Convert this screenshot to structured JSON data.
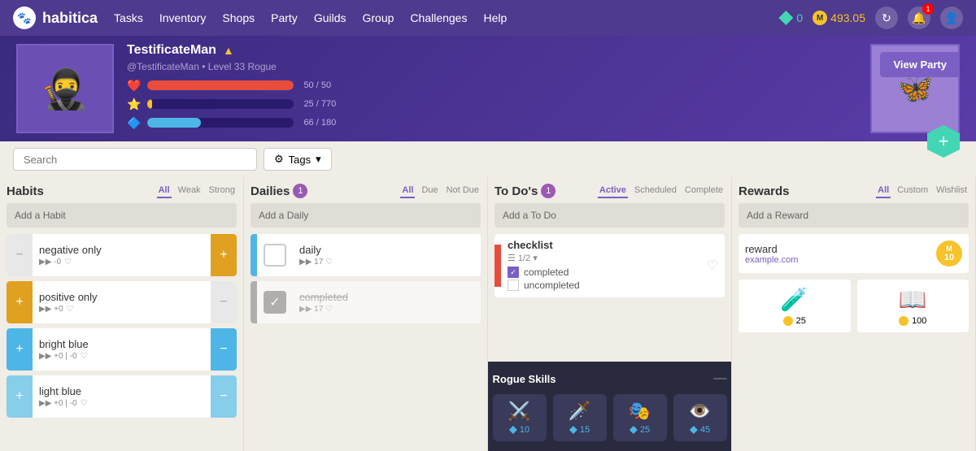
{
  "navbar": {
    "brand": "habitica",
    "brand_icon": "🐾",
    "links": [
      "Tasks",
      "Inventory",
      "Shops",
      "Party",
      "Guilds",
      "Group",
      "Challenges",
      "Help"
    ],
    "gem_count": "0",
    "gold_count": "493.05",
    "notification_count": "1"
  },
  "profile": {
    "username": "TestificateMan",
    "handle": "@TestificateMan",
    "level": "Level 33 Rogue",
    "hp_current": "50",
    "hp_max": "50",
    "hp_pct": 100,
    "xp_current": "25",
    "xp_max": "770",
    "xp_pct": 3.2,
    "mp_current": "66",
    "mp_max": "180",
    "mp_pct": 36.7,
    "view_party_label": "View Party",
    "add_label": "+"
  },
  "search": {
    "placeholder": "Search",
    "tags_label": "Tags"
  },
  "habits": {
    "title": "Habits",
    "filters": [
      "All",
      "Weak",
      "Strong"
    ],
    "active_filter": "All",
    "add_label": "Add a Habit",
    "items": [
      {
        "name": "negative only",
        "color": "#e0a020",
        "stats": "▶▶ -0",
        "left_color": "#e8e8e8",
        "right_color": "#e0a020"
      },
      {
        "name": "positive only",
        "color": "#e0a020",
        "stats": "▶▶ +0",
        "left_color": "#e0a020",
        "right_color": "#e8e8e8"
      },
      {
        "name": "bright blue",
        "color": "#4db6e6",
        "stats": "▶▶ +0 | -0",
        "left_color": "#4db6e6",
        "right_color": "#4db6e6"
      },
      {
        "name": "light blue",
        "color": "#87ceeb",
        "stats": "▶▶ +0 | -0",
        "left_color": "#87ceeb",
        "right_color": "#87ceeb"
      }
    ]
  },
  "dailies": {
    "title": "Dailies",
    "badge": "1",
    "filters": [
      "All",
      "Due",
      "Not Due"
    ],
    "active_filter": "All",
    "add_label": "Add a Daily",
    "items": [
      {
        "name": "daily",
        "color": "#4db6e6",
        "stats": "▶▶ 17",
        "checked": false
      },
      {
        "name": "completed",
        "color": "#888888",
        "stats": "▶▶ 17",
        "checked": true
      }
    ]
  },
  "todos": {
    "title": "To Do's",
    "badge": "1",
    "filters": [
      "Active",
      "Scheduled",
      "Complete"
    ],
    "active_filter": "Active",
    "add_label": "Add a To Do",
    "items": [
      {
        "name": "checklist",
        "subtask_count": "1/2",
        "subitems": [
          {
            "name": "completed",
            "checked": true
          },
          {
            "name": "uncompleted",
            "checked": false
          }
        ]
      }
    ]
  },
  "rewards": {
    "title": "Rewards",
    "filters": [
      "All",
      "Custom",
      "Wishlist"
    ],
    "active_filter": "All",
    "add_label": "Add a Reward",
    "named_rewards": [
      {
        "name": "reward",
        "link": "example.com",
        "cost": "10",
        "cost_letter": "M"
      }
    ],
    "item_rewards": [
      {
        "icon": "🧪",
        "cost": "25",
        "cost_type": "gold"
      },
      {
        "icon": "📖",
        "cost": "100",
        "cost_type": "gold"
      }
    ]
  },
  "rogue_popup": {
    "title": "Rogue Skills",
    "close": "—",
    "skills": [
      {
        "icon": "⚔️",
        "cost": "10"
      },
      {
        "icon": "🗡️",
        "cost": "15"
      },
      {
        "icon": "🎭",
        "cost": "25"
      },
      {
        "icon": "👁️",
        "cost": "45"
      }
    ]
  }
}
